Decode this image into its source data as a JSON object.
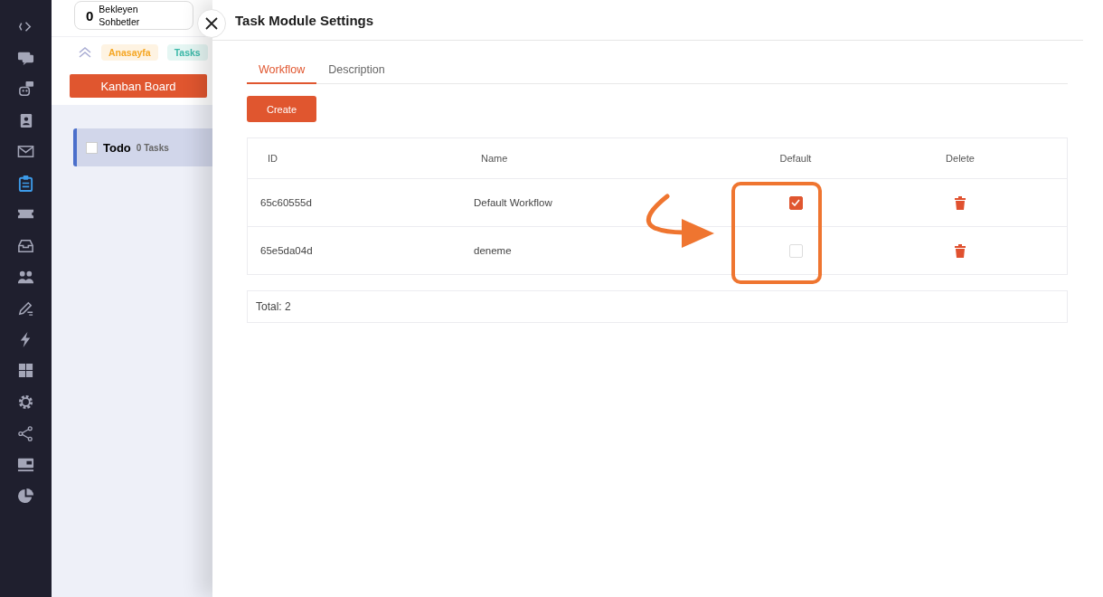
{
  "sidebar": {
    "items": [
      {
        "kind": "expand",
        "selected": false
      },
      {
        "kind": "chat",
        "selected": false
      },
      {
        "kind": "bot",
        "selected": false
      },
      {
        "kind": "contacts",
        "selected": false
      },
      {
        "kind": "mail",
        "selected": false
      },
      {
        "kind": "tasks",
        "selected": true
      },
      {
        "kind": "ticket",
        "selected": false
      },
      {
        "kind": "inbox",
        "selected": false
      },
      {
        "kind": "users",
        "selected": false
      },
      {
        "kind": "edit",
        "selected": false
      },
      {
        "kind": "bolt",
        "selected": false
      },
      {
        "kind": "grid",
        "selected": false
      },
      {
        "kind": "settings",
        "selected": false
      },
      {
        "kind": "share",
        "selected": false
      },
      {
        "kind": "card",
        "selected": false
      },
      {
        "kind": "pie",
        "selected": false
      }
    ]
  },
  "header": {
    "waiting_count": "0",
    "waiting_label": "Bekleyen Sohbetler"
  },
  "breadcrumbs": [
    {
      "label": "Anasayfa",
      "color": "#f5a623"
    },
    {
      "label": "Tasks",
      "color": "#3bb8a8"
    }
  ],
  "board_button": "Kanban Board",
  "column": {
    "title": "Todo",
    "count": "0 Tasks",
    "checked": false
  },
  "drawer": {
    "title": "Task Module Settings",
    "tabs": [
      {
        "label": "Workflow",
        "selected": true
      },
      {
        "label": "Description",
        "selected": false
      }
    ],
    "create_button": "Create",
    "table": {
      "columns": [
        "ID",
        "Name",
        "Default",
        "Delete"
      ],
      "rows": [
        {
          "id": "65c60555d",
          "name": "Default Workflow",
          "default": true
        },
        {
          "id": "65e5da04d",
          "name": "deneme",
          "default": false
        }
      ]
    },
    "total": "Total: 2"
  }
}
